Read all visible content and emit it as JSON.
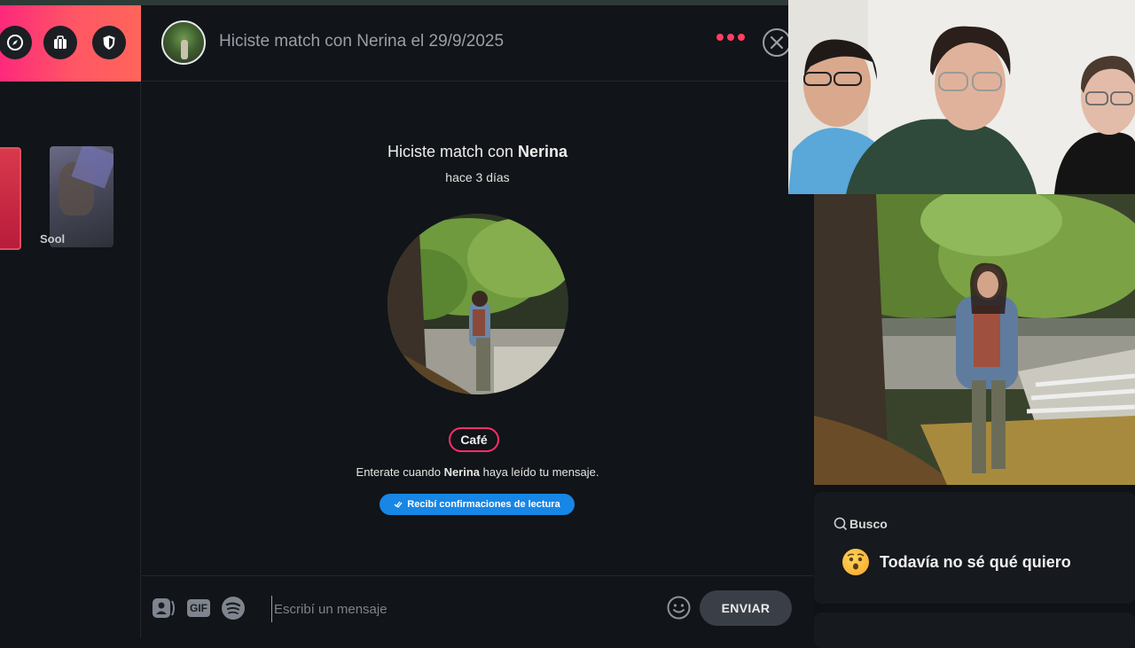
{
  "sidebar": {
    "nav_icons": [
      "explore-icon",
      "briefcase-icon",
      "shield-icon"
    ],
    "match_cards": [
      {
        "name": ""
      },
      {
        "name": "Sool"
      }
    ]
  },
  "chat": {
    "header_title": "Hiciste match con Nerina el 29/9/2025",
    "match_prefix": "Hiciste match con ",
    "match_name": "Nerina",
    "match_time": "hace 3 días",
    "interest_tag": "Café",
    "read_note_prefix": "Enterate cuando ",
    "read_note_name": "Nerina",
    "read_note_suffix": " haya leído tu mensaje.",
    "read_receipts_button": "Recibí confirmaciones de lectura",
    "composer": {
      "gif_label": "GIF",
      "placeholder": "Escribí un mensaje",
      "send_label": "ENVIAR"
    }
  },
  "profile": {
    "busco_label": "Busco",
    "busco_value": "Todavía no sé qué quiero"
  },
  "colors": {
    "brand_gradient_start": "#fd297b",
    "brand_gradient_end": "#ff655b",
    "accent_pink": "#fd3f62",
    "read_button_blue": "#1786e5"
  }
}
